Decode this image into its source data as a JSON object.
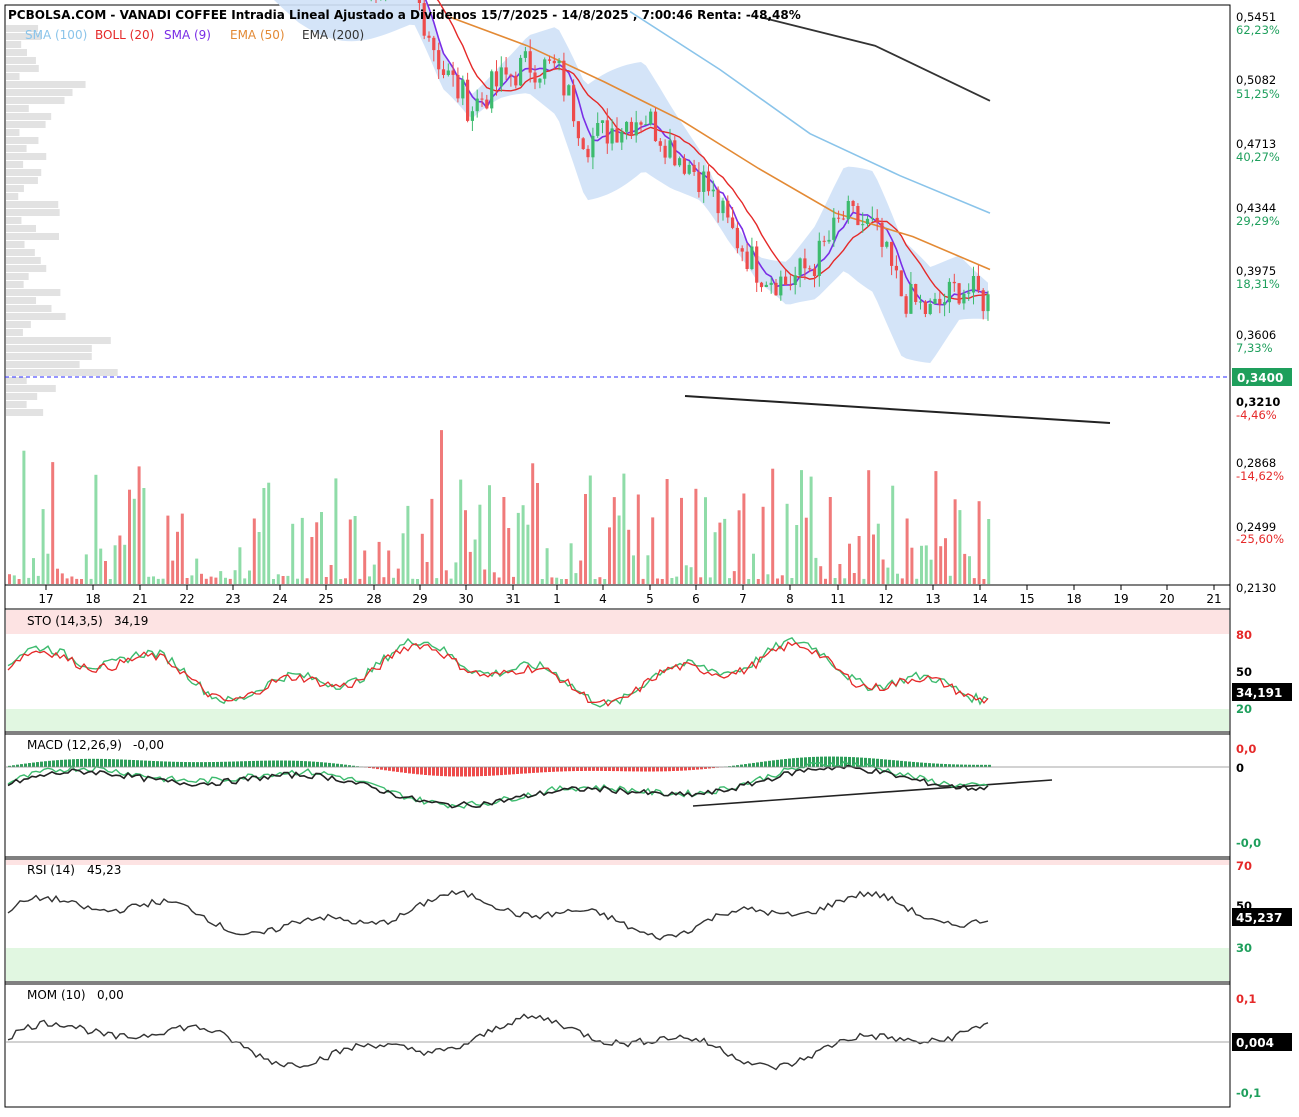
{
  "header": {
    "title": "PCBOLSA.COM - VANADI COFFEE Intradia Lineal Ajustado a Dividenos 15/7/2025 - 14/8/2025 , 7:00:46 Renta: -48,48%"
  },
  "legend": [
    {
      "label": "SMA (100)",
      "color": "#8ac4ea"
    },
    {
      "label": "BOLL (20)",
      "color": "#e52929"
    },
    {
      "label": "SMA (9)",
      "color": "#7a2ee6"
    },
    {
      "label": "EMA (50)",
      "color": "#e38a35"
    },
    {
      "label": "EMA (200)",
      "color": "#333333"
    }
  ],
  "colors": {
    "up": "#3dbb6e",
    "down": "#ee4b4b",
    "up_volume": "#8fdca8",
    "down_volume": "#f07a7a",
    "boll_fill": "#cfe1f7",
    "current_price_line": "#2b2bff",
    "current_price_box": "#1e9f5c",
    "overbought_fill": "#fde3e3",
    "oversold_fill": "#e1f7e1",
    "sma100": "#8ac4ea",
    "boll": "#e52929",
    "sma9": "#7a2ee6",
    "ema50": "#e38a35",
    "ema200": "#333333",
    "trendline": "#222222",
    "volume_profile": "#e2e2e2"
  },
  "price_axis": {
    "ticks": [
      {
        "price": "0,5451",
        "pct": "62,23%"
      },
      {
        "price": "0,5082",
        "pct": "51,25%"
      },
      {
        "price": "0,4713",
        "pct": "40,27%"
      },
      {
        "price": "0,4344",
        "pct": "29,29%"
      },
      {
        "price": "0,3975",
        "pct": "18,31%"
      },
      {
        "price": "0,3606",
        "pct": "7,33%"
      },
      {
        "price": "0,3210",
        "pct": "-4,46%"
      },
      {
        "price": "0,2868",
        "pct": "-14,62%"
      },
      {
        "price": "0,2499",
        "pct": "-25,60%"
      },
      {
        "price": "0,2130",
        "pct": ""
      }
    ],
    "current_price": "0,3400"
  },
  "date_axis": [
    "17",
    "18",
    "21",
    "22",
    "23",
    "24",
    "25",
    "28",
    "29",
    "30",
    "31",
    "1",
    "4",
    "5",
    "6",
    "7",
    "8",
    "11",
    "12",
    "13",
    "14",
    "15",
    "18",
    "19",
    "20",
    "21"
  ],
  "panels": {
    "sto": {
      "label": "STO (14,3,5)",
      "value": "34,19",
      "ticks": [
        "80",
        "50",
        "20"
      ],
      "box": "34,191"
    },
    "macd": {
      "label": "MACD (12,26,9)",
      "value": "-0,00",
      "ticks": [
        "0,0",
        "0",
        "-0,0"
      ]
    },
    "rsi": {
      "label": "RSI (14)",
      "value": "45,23",
      "ticks": [
        "70",
        "50",
        "30"
      ],
      "box": "45,237"
    },
    "mom": {
      "label": "MOM (10)",
      "value": "0,00",
      "ticks": [
        "0,1",
        "-0,1"
      ],
      "box": "0,004"
    }
  },
  "chart_data": [
    {
      "type": "candlestick",
      "title": "PCBOLSA.COM - VANADI COFFEE Intradia Lineal Ajustado a Dividenos 15/7/2025 - 14/8/2025 , 7:00:46 Renta: -48,48%",
      "x_labels": [
        "17",
        "18",
        "21",
        "22",
        "23",
        "24",
        "25",
        "28",
        "29",
        "30",
        "31",
        "1",
        "4",
        "5",
        "6",
        "7",
        "8",
        "11",
        "12",
        "13",
        "14"
      ],
      "close_path": [
        0.6,
        0.59,
        0.585,
        0.58,
        0.575,
        0.57,
        0.5,
        0.47,
        0.49,
        0.505,
        0.5,
        0.445,
        0.455,
        0.465,
        0.44,
        0.42,
        0.385,
        0.36,
        0.352,
        0.365,
        0.393,
        0.385,
        0.345,
        0.335,
        0.35,
        0.342
      ],
      "series": [
        {
          "name": "SMA (100)",
          "values": [
            0.55,
            0.5,
            0.45,
            0.42,
            0.395
          ]
        },
        {
          "name": "EMA (50)",
          "values": [
            0.545,
            0.52,
            0.49,
            0.46,
            0.425,
            0.395,
            0.38,
            0.36
          ]
        },
        {
          "name": "EMA (200)",
          "values": [
            0.545,
            0.52,
            0.475
          ]
        }
      ],
      "current_price": 0.34,
      "ylim": [
        0.213,
        0.5451
      ],
      "log_scale": true
    },
    {
      "type": "line",
      "title": "STO (14,3,5)",
      "last_value": 34.19,
      "ylim": [
        0,
        100
      ],
      "bands": [
        20,
        80
      ]
    },
    {
      "type": "bar",
      "title": "MACD (12,26,9)",
      "last_value": -0.0
    },
    {
      "type": "line",
      "title": "RSI (14)",
      "last_value": 45.23,
      "ylim": [
        0,
        100
      ],
      "bands": [
        30,
        70
      ]
    },
    {
      "type": "line",
      "title": "MOM (10)",
      "last_value": 0.0
    }
  ]
}
